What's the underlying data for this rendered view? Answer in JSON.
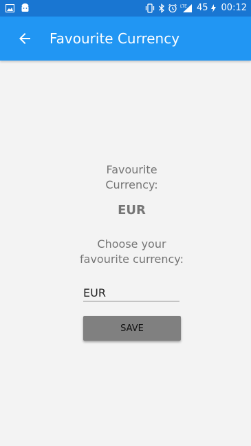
{
  "status_bar": {
    "battery_level": "45",
    "time": "00:12",
    "network_label": "LTE",
    "icons": [
      "image-icon",
      "android-icon",
      "vibrate-icon",
      "bluetooth-icon",
      "alarm-icon",
      "signal-icon",
      "charging-icon"
    ]
  },
  "app_bar": {
    "title": "Favourite Currency",
    "back_icon": "arrow-back-icon"
  },
  "content": {
    "favourite_label_line1": "Favourite",
    "favourite_label_line2": "Currency:",
    "favourite_value": "EUR",
    "choose_label_line1": "Choose your",
    "choose_label_line2": "favourite currency:",
    "input_value": "EUR",
    "save_label": "SAVE"
  },
  "colors": {
    "status_bar": "#1976d2",
    "app_bar": "#2196f3",
    "background": "#f3f3f3",
    "button": "#808080",
    "text_secondary": "#757575"
  }
}
